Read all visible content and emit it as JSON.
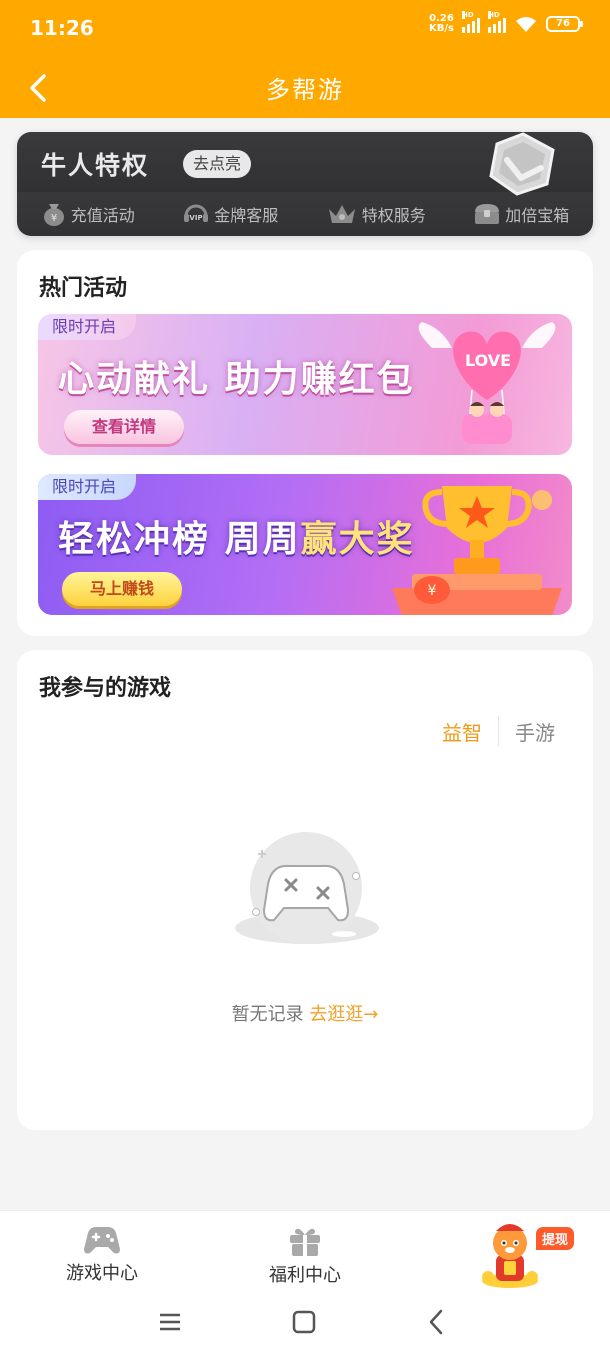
{
  "status_bar": {
    "time": "11:26",
    "net_speed_value": "0.26",
    "net_speed_unit": "KB/s",
    "hd_label": "HD",
    "battery": "76"
  },
  "header": {
    "title": "多帮游"
  },
  "vip_card": {
    "title": "牛人特权",
    "cta": "去点亮",
    "items": [
      {
        "label": "充值活动",
        "icon": "money-bag-icon"
      },
      {
        "label": "金牌客服",
        "icon": "vip-headset-icon"
      },
      {
        "label": "特权服务",
        "icon": "crown-icon"
      },
      {
        "label": "加倍宝箱",
        "icon": "treasure-chest-icon"
      }
    ]
  },
  "hot_activities": {
    "title": "热门活动",
    "banners": [
      {
        "tag": "限时开启",
        "headline_a": "心动献礼",
        "headline_b": "助力赚红包",
        "button": "查看详情",
        "art_text": "LOVE"
      },
      {
        "tag": "限时开启",
        "headline_a": "轻松冲榜",
        "headline_b": "周周",
        "headline_c": "赢大奖",
        "button": "马上赚钱"
      }
    ]
  },
  "my_games": {
    "title": "我参与的游戏",
    "tabs": [
      {
        "label": "益智",
        "active": true
      },
      {
        "label": "手游",
        "active": false
      }
    ],
    "empty_text": "暂无记录",
    "empty_link": "去逛逛→"
  },
  "bottom_nav": {
    "items": [
      {
        "label": "游戏中心",
        "icon": "gamepad-icon"
      },
      {
        "label": "福利中心",
        "icon": "gift-icon"
      }
    ],
    "withdraw_badge": "提现"
  },
  "colors": {
    "brand": "#ffa800",
    "accent": "#f09a1a",
    "vip_bg": "#2e2e30"
  }
}
